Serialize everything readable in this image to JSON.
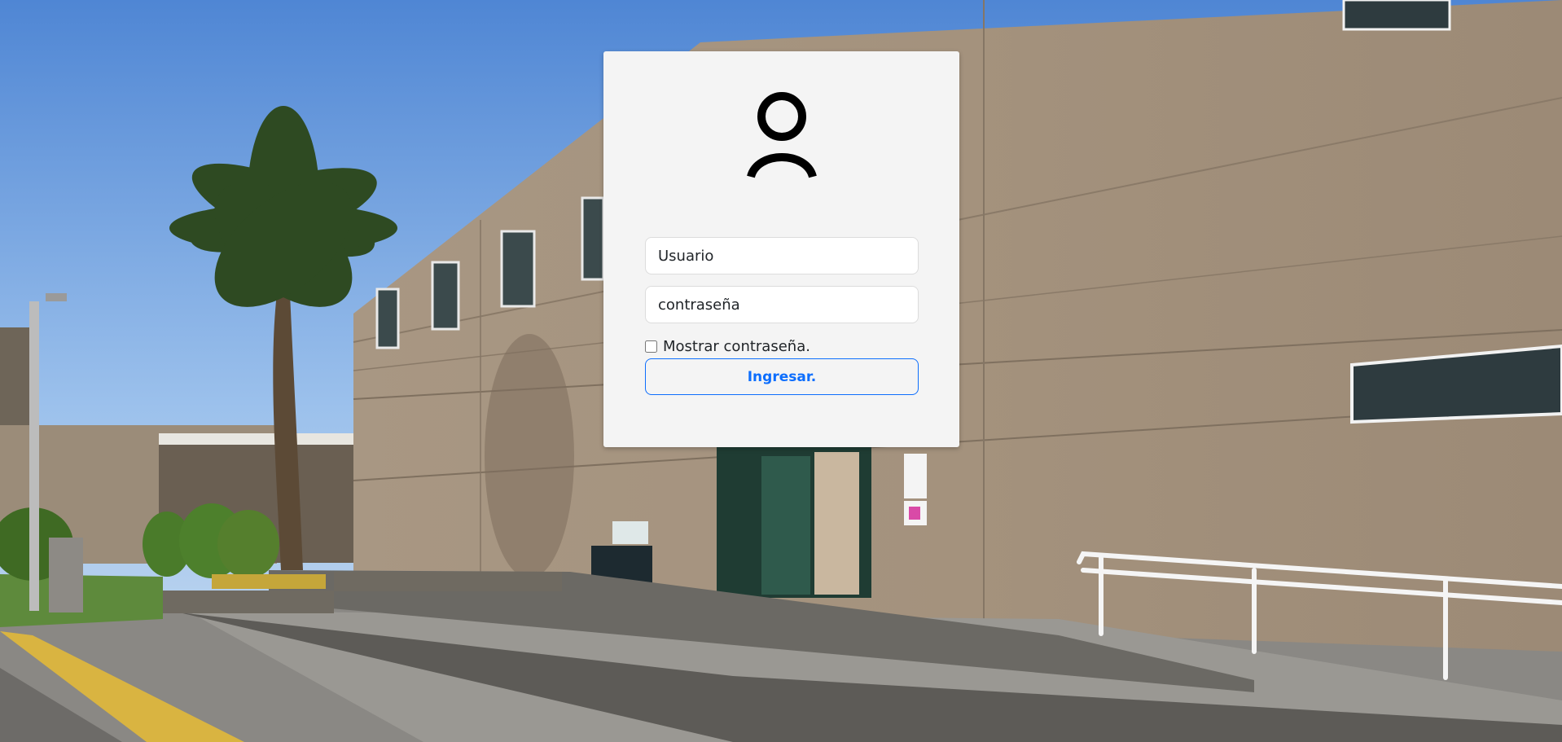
{
  "login": {
    "avatar_icon": "user-icon",
    "username_placeholder": "Usuario",
    "password_placeholder": "contraseña",
    "show_password_label": "Mostrar contraseña.",
    "show_password_checked": false,
    "submit_label": "Ingresar."
  },
  "colors": {
    "card_background": "#f4f4f4",
    "accent": "#0d6efd"
  }
}
